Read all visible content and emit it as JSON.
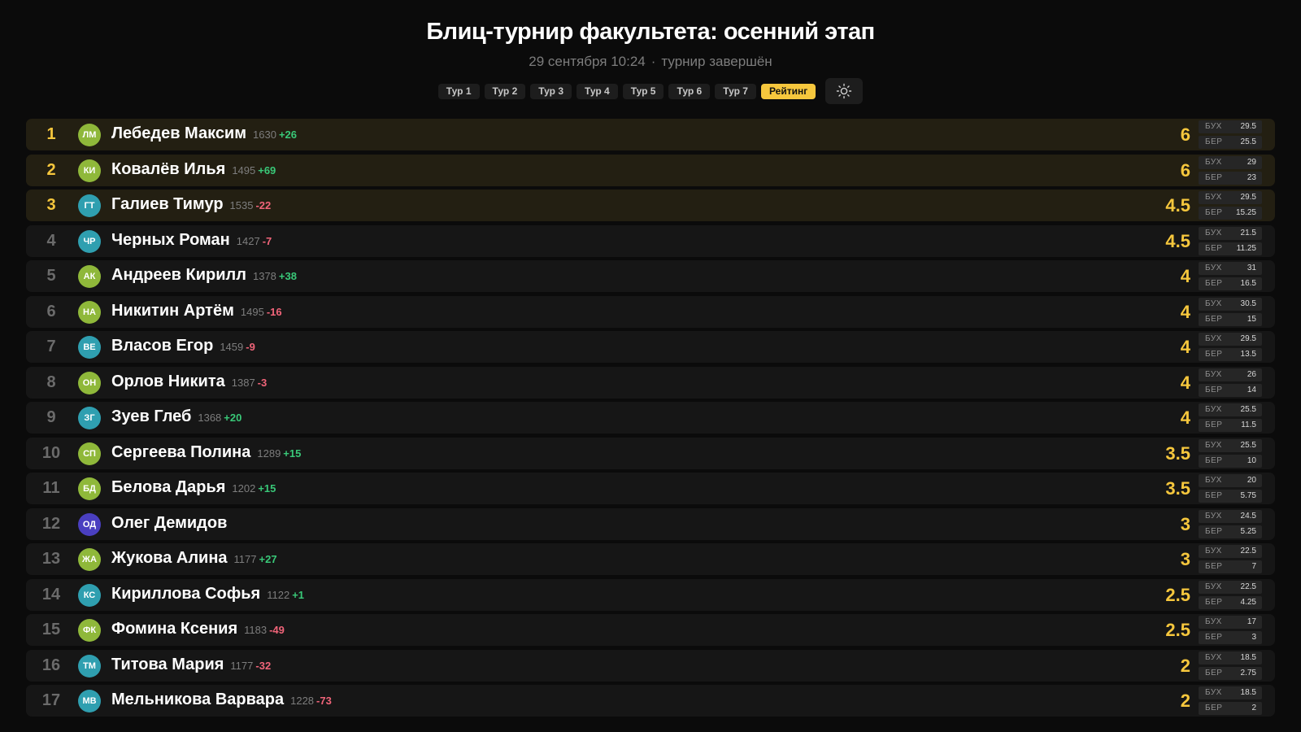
{
  "header": {
    "title": "Блиц-турнир факультета: осенний этап",
    "date": "29 сентября 10:24",
    "separator": "·",
    "status": "турнир завершён"
  },
  "tabs": [
    {
      "label": "Тур 1",
      "active": false
    },
    {
      "label": "Тур 2",
      "active": false
    },
    {
      "label": "Тур 3",
      "active": false
    },
    {
      "label": "Тур 4",
      "active": false
    },
    {
      "label": "Тур 5",
      "active": false
    },
    {
      "label": "Тур 6",
      "active": false
    },
    {
      "label": "Тур 7",
      "active": false
    },
    {
      "label": "Рейтинг",
      "active": true
    }
  ],
  "theme_toggle": {
    "icon": "sun-icon"
  },
  "colors": {
    "accent": "#f6c73d",
    "positive": "#39c878",
    "negative": "#f06479",
    "avatar_green": "#8fb83a",
    "avatar_teal": "#2f9fb0",
    "avatar_purple": "#4a3fc0"
  },
  "tiebreak_labels": {
    "buh": "БУХ",
    "ber": "БЕР"
  },
  "players": [
    {
      "place": "1",
      "initials": "ЛМ",
      "avatar_color": "#8fb83a",
      "name": "Лебедев Максим",
      "rating": "1630",
      "delta": "+26",
      "score": "6",
      "buh": "29.5",
      "ber": "25.5"
    },
    {
      "place": "2",
      "initials": "КИ",
      "avatar_color": "#8fb83a",
      "name": "Ковалёв Илья",
      "rating": "1495",
      "delta": "+69",
      "score": "6",
      "buh": "29",
      "ber": "23"
    },
    {
      "place": "3",
      "initials": "ГТ",
      "avatar_color": "#2f9fb0",
      "name": "Галиев Тимур",
      "rating": "1535",
      "delta": "-22",
      "score": "4.5",
      "buh": "29.5",
      "ber": "15.25"
    },
    {
      "place": "4",
      "initials": "ЧР",
      "avatar_color": "#2f9fb0",
      "name": "Черных Роман",
      "rating": "1427",
      "delta": "-7",
      "score": "4.5",
      "buh": "21.5",
      "ber": "11.25"
    },
    {
      "place": "5",
      "initials": "АК",
      "avatar_color": "#8fb83a",
      "name": "Андреев Кирилл",
      "rating": "1378",
      "delta": "+38",
      "score": "4",
      "buh": "31",
      "ber": "16.5"
    },
    {
      "place": "6",
      "initials": "НА",
      "avatar_color": "#8fb83a",
      "name": "Никитин Артём",
      "rating": "1495",
      "delta": "-16",
      "score": "4",
      "buh": "30.5",
      "ber": "15"
    },
    {
      "place": "7",
      "initials": "ВЕ",
      "avatar_color": "#2f9fb0",
      "name": "Власов Егор",
      "rating": "1459",
      "delta": "-9",
      "score": "4",
      "buh": "29.5",
      "ber": "13.5"
    },
    {
      "place": "8",
      "initials": "ОН",
      "avatar_color": "#8fb83a",
      "name": "Орлов Никита",
      "rating": "1387",
      "delta": "-3",
      "score": "4",
      "buh": "26",
      "ber": "14"
    },
    {
      "place": "9",
      "initials": "ЗГ",
      "avatar_color": "#2f9fb0",
      "name": "Зуев Глеб",
      "rating": "1368",
      "delta": "+20",
      "score": "4",
      "buh": "25.5",
      "ber": "11.5"
    },
    {
      "place": "10",
      "initials": "СП",
      "avatar_color": "#8fb83a",
      "name": "Сергеева Полина",
      "rating": "1289",
      "delta": "+15",
      "score": "3.5",
      "buh": "25.5",
      "ber": "10"
    },
    {
      "place": "11",
      "initials": "БД",
      "avatar_color": "#8fb83a",
      "name": "Белова Дарья",
      "rating": "1202",
      "delta": "+15",
      "score": "3.5",
      "buh": "20",
      "ber": "5.75"
    },
    {
      "place": "12",
      "initials": "ОД",
      "avatar_color": "#4a3fc0",
      "name": "Олег Демидов",
      "rating": "",
      "delta": "",
      "score": "3",
      "buh": "24.5",
      "ber": "5.25"
    },
    {
      "place": "13",
      "initials": "ЖА",
      "avatar_color": "#8fb83a",
      "name": "Жукова Алина",
      "rating": "1177",
      "delta": "+27",
      "score": "3",
      "buh": "22.5",
      "ber": "7"
    },
    {
      "place": "14",
      "initials": "КС",
      "avatar_color": "#2f9fb0",
      "name": "Кириллова Софья",
      "rating": "1122",
      "delta": "+1",
      "score": "2.5",
      "buh": "22.5",
      "ber": "4.25"
    },
    {
      "place": "15",
      "initials": "ФК",
      "avatar_color": "#8fb83a",
      "name": "Фомина Ксения",
      "rating": "1183",
      "delta": "-49",
      "score": "2.5",
      "buh": "17",
      "ber": "3"
    },
    {
      "place": "16",
      "initials": "ТМ",
      "avatar_color": "#2f9fb0",
      "name": "Титова Мария",
      "rating": "1177",
      "delta": "-32",
      "score": "2",
      "buh": "18.5",
      "ber": "2.75"
    },
    {
      "place": "17",
      "initials": "МВ",
      "avatar_color": "#2f9fb0",
      "name": "Мельникова Варвара",
      "rating": "1228",
      "delta": "-73",
      "score": "2",
      "buh": "18.5",
      "ber": "2"
    }
  ]
}
